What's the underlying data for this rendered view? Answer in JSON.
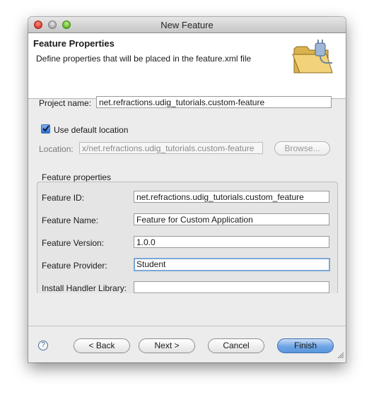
{
  "window": {
    "title": "New Feature"
  },
  "banner": {
    "title": "Feature Properties",
    "description": "Define properties that will be placed in the feature.xml file"
  },
  "project": {
    "label": "Project name:",
    "value": "net.refractions.udig_tutorials.custom-feature"
  },
  "location": {
    "use_default_label": "Use default location",
    "use_default_checked": true,
    "label": "Location:",
    "value": "x/net.refractions.udig_tutorials.custom-feature",
    "browse_label": "Browse..."
  },
  "feature_properties": {
    "group_label": "Feature properties",
    "fields": [
      {
        "label": "Feature ID:",
        "value": "net.refractions.udig_tutorials.custom_feature"
      },
      {
        "label": "Feature Name:",
        "value": "Feature for Custom Application"
      },
      {
        "label": "Feature Version:",
        "value": "1.0.0"
      },
      {
        "label": "Feature Provider:",
        "value": "Student"
      },
      {
        "label": "Install Handler Library:",
        "value": ""
      }
    ]
  },
  "buttons": {
    "help": "?",
    "back": "< Back",
    "next": "Next >",
    "cancel": "Cancel",
    "finish": "Finish"
  },
  "colors": {
    "accent": "#6ea5e6",
    "window_bg": "#ececec"
  },
  "icons": {
    "banner": "folder-plug-icon",
    "help": "help-icon",
    "resize": "resize-grip-icon"
  }
}
